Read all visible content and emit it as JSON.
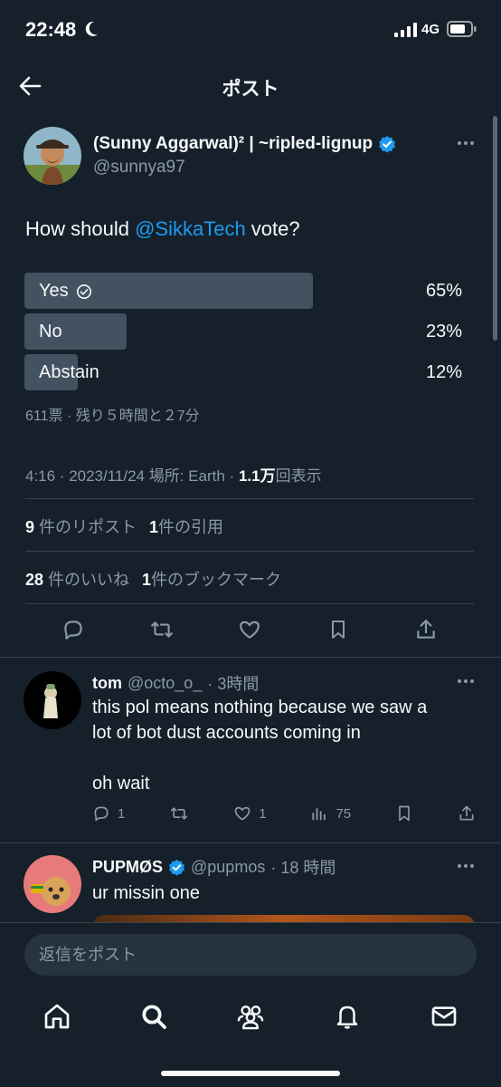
{
  "status_bar": {
    "time": "22:48",
    "network": "4G"
  },
  "header": {
    "title": "ポスト"
  },
  "post": {
    "author_name": "(Sunny Aggarwal)² | ~ripled-lignup",
    "author_handle": "@sunnya97",
    "text_before": "How should ",
    "mention": "@SikkaTech",
    "text_after": " vote?",
    "poll": {
      "options": [
        {
          "label": "Yes",
          "percent_text": "65%",
          "value": 65,
          "winner": true
        },
        {
          "label": "No",
          "percent_text": "23%",
          "value": 23,
          "winner": false
        },
        {
          "label": "Abstain",
          "percent_text": "12%",
          "value": 12,
          "winner": false
        }
      ],
      "meta": "611票 · 残り５時間と２7分"
    },
    "timestamp_prefix": "4:16 · 2023/11/24 場所: Earth · ",
    "views_count": "1.1万",
    "views_suffix": "回表示",
    "reposts_count": "9",
    "reposts_label": "件のリポスト",
    "quotes_count": "1",
    "quotes_label": "件の引用",
    "likes_count": "28",
    "likes_label": "件のいいね",
    "bookmarks_count": "1",
    "bookmarks_label": "件のブックマーク"
  },
  "replies": [
    {
      "name": "tom",
      "handle": "@octo_o_",
      "time": "· 3時間",
      "text_line1": "this pol means nothing because we saw a",
      "text_line2": "lot of bot dust accounts coming in",
      "text_line3": "oh wait",
      "reply_count": "1",
      "like_count": "1",
      "view_count": "75"
    },
    {
      "name": "PUPMØS",
      "handle": "@pupmos",
      "time": "· 18 時間",
      "text_line1": "ur missin one"
    }
  ],
  "composer": {
    "placeholder": "返信をポスト"
  },
  "colors": {
    "background": "#15202b",
    "accent": "#1d9bf0",
    "poll_bar": "#435261",
    "muted_text": "#8b98a5"
  }
}
